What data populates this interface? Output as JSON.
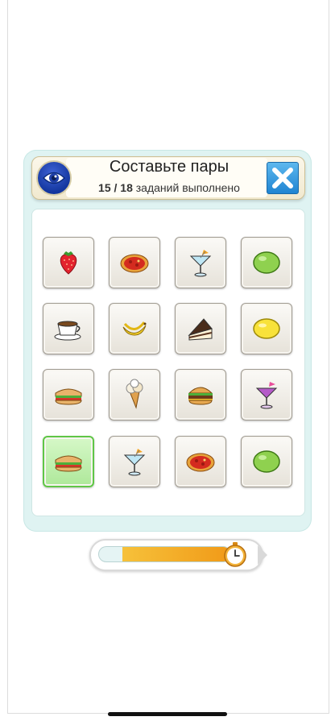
{
  "header": {
    "title": "Составьте пары",
    "progress_done": "15 / 18",
    "progress_text": "заданий выполнено",
    "eye_icon": "eye-icon",
    "close_icon": "close-icon"
  },
  "board": {
    "tiles": [
      {
        "icon": "strawberry-icon",
        "selected": false
      },
      {
        "icon": "pizza-slice-icon",
        "selected": false
      },
      {
        "icon": "cocktail-icon",
        "selected": false
      },
      {
        "icon": "lime-icon",
        "selected": false
      },
      {
        "icon": "coffee-cup-icon",
        "selected": false
      },
      {
        "icon": "banana-icon",
        "selected": false
      },
      {
        "icon": "cake-slice-icon",
        "selected": false
      },
      {
        "icon": "lemon-icon",
        "selected": false
      },
      {
        "icon": "sandwich-icon",
        "selected": false
      },
      {
        "icon": "ice-cream-cone-icon",
        "selected": false
      },
      {
        "icon": "burger-icon",
        "selected": false
      },
      {
        "icon": "purple-cocktail-icon",
        "selected": false
      },
      {
        "icon": "sandwich-icon",
        "selected": true
      },
      {
        "icon": "cocktail-icon",
        "selected": false
      },
      {
        "icon": "pizza-slice-icon",
        "selected": false
      },
      {
        "icon": "lime-icon",
        "selected": false
      }
    ]
  },
  "timer": {
    "remaining_fraction": 0.82,
    "icon": "stopwatch-icon"
  },
  "colors": {
    "panel": "#dff3f2",
    "selected_tile": "#aee89a",
    "timer_fill": "#f19a18"
  }
}
